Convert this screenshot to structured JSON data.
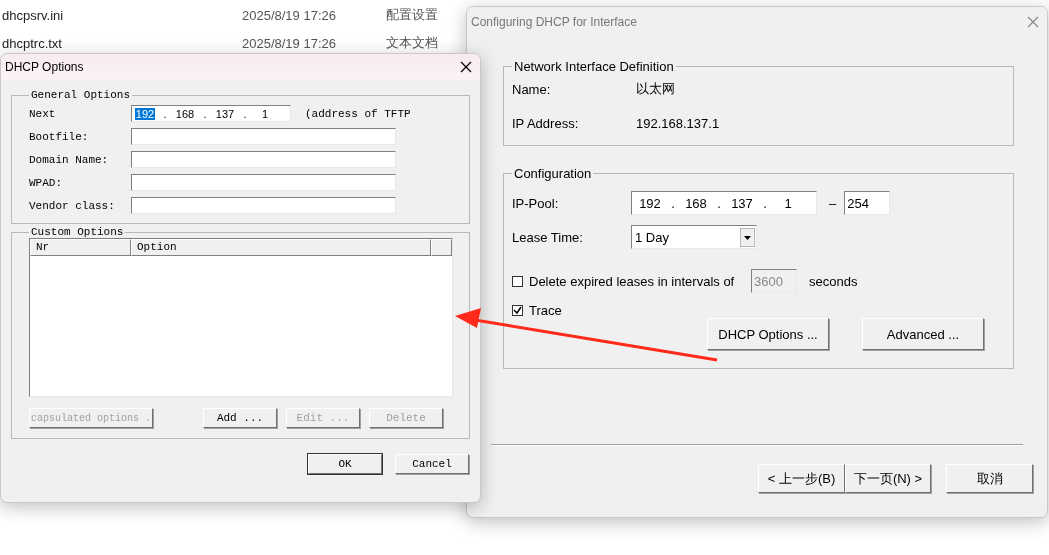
{
  "explorer_rows": [
    {
      "name": "dhcpsrv.ini",
      "date": "2025/8/19 17:26",
      "type": "配置设置"
    },
    {
      "name": "dhcptrc.txt",
      "date": "2025/8/19 17:26",
      "type": "文本文档"
    }
  ],
  "config_window": {
    "title": "Configuring DHCP for Interface",
    "interface_group": {
      "title": "Network Interface Definition",
      "name_label": "Name:",
      "name_value": "以太网",
      "ip_label": "IP Address:",
      "ip_value": "192.168.137.1"
    },
    "config_group": {
      "title": "Configuration",
      "pool_label": "IP-Pool:",
      "pool_octets": [
        "192",
        "168",
        "137",
        "1"
      ],
      "pool_separator": ".",
      "pool_dash": "–",
      "pool_end": "254",
      "lease_label": "Lease Time:",
      "lease_value": "1 Day",
      "delete_expired": {
        "label": "Delete expired leases in intervals of",
        "checked": false,
        "interval": "3600",
        "interval_disabled": true,
        "unit": "seconds"
      },
      "trace": {
        "label": "Trace",
        "checked": true
      },
      "buttons": [
        "DHCP Options ...",
        "Advanced ..."
      ]
    },
    "nav_buttons": [
      "< 上一步(B)",
      "下一页(N) >",
      "取消"
    ]
  },
  "options_dialog": {
    "title": "DHCP Options",
    "general": {
      "title": "General Options",
      "fields": [
        {
          "label": "Next",
          "kind": "ip",
          "separator": ".",
          "octets": [
            {
              "text": "192",
              "selected": true
            },
            {
              "text": "168",
              "selected": false
            },
            {
              "text": "137",
              "selected": false
            },
            {
              "text": "1",
              "selected": false
            }
          ],
          "note": "(address of TFTP"
        },
        {
          "label": "Bootfile:",
          "kind": "text"
        },
        {
          "label": "Domain Name:",
          "kind": "text"
        },
        {
          "label": "WPAD:",
          "kind": "text"
        },
        {
          "label": "Vendor class:",
          "kind": "text"
        }
      ]
    },
    "custom": {
      "title": "Custom Options",
      "columns": [
        "Nr",
        "Option"
      ],
      "buttons": [
        {
          "label": "capsulated options .",
          "disabled": true
        },
        {
          "label": "Add ...",
          "disabled": false
        },
        {
          "label": "Edit ...",
          "disabled": true
        },
        {
          "label": "Delete",
          "disabled": true
        }
      ]
    },
    "buttons": [
      "OK",
      "Cancel"
    ]
  }
}
